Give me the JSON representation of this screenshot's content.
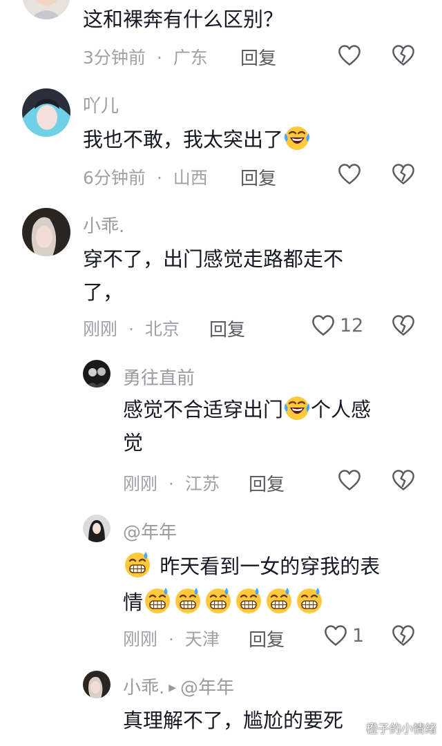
{
  "comments": [
    {
      "username": "",
      "text": "这和裸奔有什么区别？",
      "time": "3分钟前",
      "location": "广东",
      "reply_label": "回复",
      "like_count": ""
    },
    {
      "username": "吖儿",
      "text": "我也不敢，我太突出了",
      "time": "6分钟前",
      "location": "山西",
      "reply_label": "回复",
      "like_count": ""
    },
    {
      "username": "小乖.",
      "text_line1": "穿不了，出门感觉走路都走不",
      "text_line2": "了，",
      "time": "刚刚",
      "location": "北京",
      "reply_label": "回复",
      "like_count": "12"
    }
  ],
  "replies": [
    {
      "username": "勇往直前",
      "text_part1": "感觉不合适穿出门",
      "text_part2": "个人感",
      "text_line2": "觉",
      "time": "刚刚",
      "location": "江苏",
      "reply_label": "回复",
      "like_count": ""
    },
    {
      "username": "@年年",
      "text_line1": "昨天看到一女的穿我的表",
      "text_line2": "情",
      "time": "刚刚",
      "location": "天津",
      "reply_label": "回复",
      "like_count": "1"
    },
    {
      "username": "小乖.",
      "reply_to": "@年年",
      "text": "真理解不了，尴尬的要死"
    }
  ],
  "separator": "·",
  "watermark": "橙子的小情绪",
  "colors": {
    "text": "#161823",
    "meta": "#a0a0a6",
    "background": "#ffffff",
    "emoji_face": "#ffc83d"
  }
}
